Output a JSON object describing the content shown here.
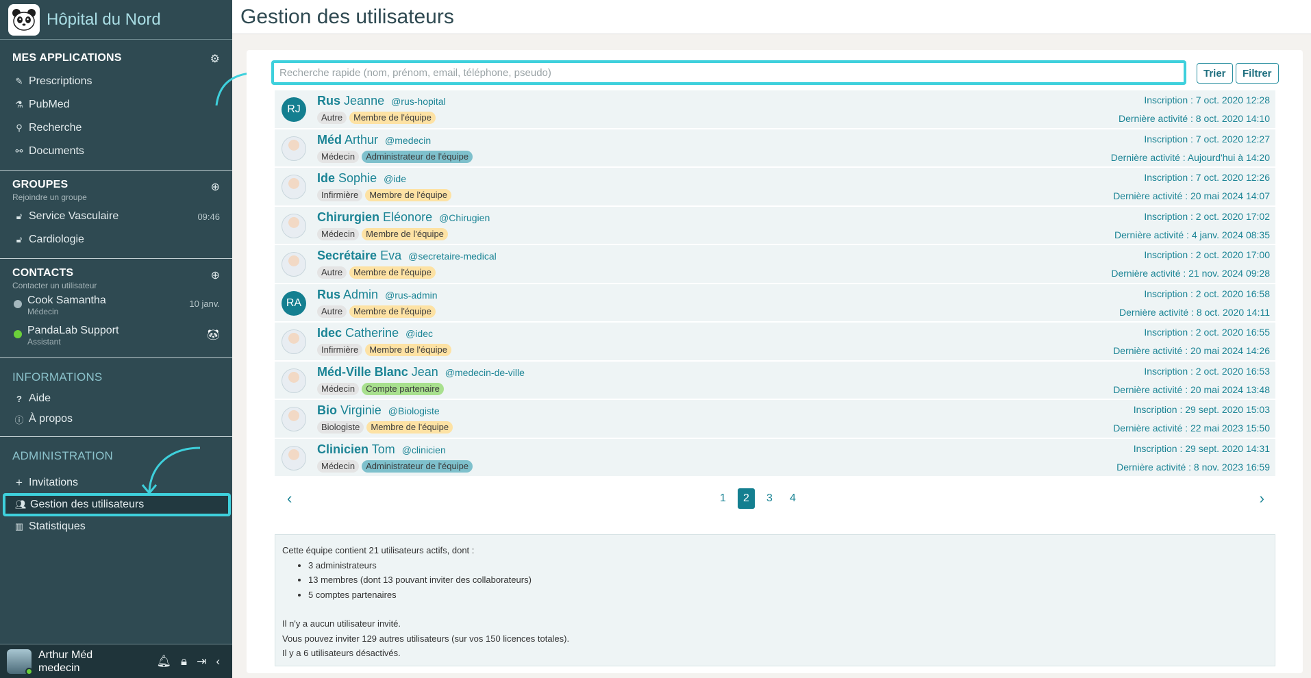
{
  "sidebar": {
    "brand": "Hôpital du Nord",
    "apps": {
      "title": "MES APPLICATIONS",
      "items": [
        {
          "label": "Prescriptions",
          "icon": "prescription-icon"
        },
        {
          "label": "PubMed",
          "icon": "pubmed-icon"
        },
        {
          "label": "Recherche",
          "icon": "search-icon"
        },
        {
          "label": "Documents",
          "icon": "paperclip-icon"
        }
      ]
    },
    "groups": {
      "title": "GROUPES",
      "subtitle": "Rejoindre un groupe",
      "items": [
        {
          "label": "Service Vasculaire",
          "meta": "09:46"
        },
        {
          "label": "Cardiologie",
          "meta": ""
        }
      ]
    },
    "contacts": {
      "title": "CONTACTS",
      "subtitle": "Contacter un utilisateur",
      "items": [
        {
          "name": "Cook Samantha",
          "role": "Médecin",
          "meta": "10 janv."
        },
        {
          "name": "PandaLab Support",
          "role": "Assistant",
          "meta": ""
        }
      ]
    },
    "informations": {
      "title": "INFORMATIONS",
      "items": [
        {
          "label": "Aide"
        },
        {
          "label": "À propos"
        }
      ]
    },
    "administration": {
      "title": "ADMINISTRATION",
      "items": [
        {
          "label": "Invitations"
        },
        {
          "label": "Gestion des utilisateurs"
        },
        {
          "label": "Statistiques"
        }
      ]
    },
    "user": {
      "first": "Arthur Méd",
      "second": "medecin"
    }
  },
  "header": {
    "title": "Gestion des utilisateurs"
  },
  "search": {
    "placeholder": "Recherche rapide (nom, prénom, email, téléphone, pseudo)"
  },
  "buttons": {
    "sort": "Trier",
    "filter": "Filtrer"
  },
  "users": [
    {
      "last": "Rus",
      "first": "Jeanne",
      "handle": "@rus-hopital",
      "role": "Autre",
      "tag": "Membre de l'équipe",
      "tag_type": "membre",
      "initials": "RJ",
      "ins": "Inscription : 7 oct. 2020 12:28",
      "act": "Dernière activité : 8 oct. 2020 14:10"
    },
    {
      "last": "Méd",
      "first": "Arthur",
      "handle": "@medecin",
      "role": "Médecin",
      "tag": "Administrateur de l'équipe",
      "tag_type": "admin",
      "initials": "",
      "ins": "Inscription : 7 oct. 2020 12:27",
      "act": "Dernière activité : Aujourd'hui à 14:20"
    },
    {
      "last": "Ide",
      "first": "Sophie",
      "handle": "@ide",
      "role": "Infirmière",
      "tag": "Membre de l'équipe",
      "tag_type": "membre",
      "initials": "",
      "ins": "Inscription : 7 oct. 2020 12:26",
      "act": "Dernière activité : 20 mai 2024 14:07"
    },
    {
      "last": "Chirurgien",
      "first": "Eléonore",
      "handle": "@Chirugien",
      "role": "Médecin",
      "tag": "Membre de l'équipe",
      "tag_type": "membre",
      "initials": "",
      "ins": "Inscription : 2 oct. 2020 17:02",
      "act": "Dernière activité : 4 janv. 2024 08:35"
    },
    {
      "last": "Secrétaire",
      "first": "Eva",
      "handle": "@secretaire-medical",
      "role": "Autre",
      "tag": "Membre de l'équipe",
      "tag_type": "membre",
      "initials": "",
      "ins": "Inscription : 2 oct. 2020 17:00",
      "act": "Dernière activité : 21 nov. 2024 09:28"
    },
    {
      "last": "Rus",
      "first": "Admin",
      "handle": "@rus-admin",
      "role": "Autre",
      "tag": "Membre de l'équipe",
      "tag_type": "membre",
      "initials": "RA",
      "ins": "Inscription : 2 oct. 2020 16:58",
      "act": "Dernière activité : 8 oct. 2020 14:11"
    },
    {
      "last": "Idec",
      "first": "Catherine",
      "handle": "@idec",
      "role": "Infirmière",
      "tag": "Membre de l'équipe",
      "tag_type": "membre",
      "initials": "",
      "ins": "Inscription : 2 oct. 2020 16:55",
      "act": "Dernière activité : 20 mai 2024 14:26"
    },
    {
      "last": "Méd-Ville Blanc",
      "first": "Jean",
      "handle": "@medecin-de-ville",
      "role": "Médecin",
      "tag": "Compte partenaire",
      "tag_type": "part",
      "initials": "",
      "ins": "Inscription : 2 oct. 2020 16:53",
      "act": "Dernière activité : 20 mai 2024 13:48"
    },
    {
      "last": "Bio",
      "first": "Virginie",
      "handle": "@Biologiste",
      "role": "Biologiste",
      "tag": "Membre de l'équipe",
      "tag_type": "membre",
      "initials": "",
      "ins": "Inscription : 29 sept. 2020 15:03",
      "act": "Dernière activité : 22 mai 2023 15:50"
    },
    {
      "last": "Clinicien",
      "first": "Tom",
      "handle": "@clinicien",
      "role": "Médecin",
      "tag": "Administrateur de l'équipe",
      "tag_type": "admin",
      "initials": "",
      "ins": "Inscription : 29 sept. 2020 14:31",
      "act": "Dernière activité : 8 nov. 2023 16:59"
    }
  ],
  "pagination": {
    "pages": [
      "1",
      "2",
      "3",
      "4"
    ],
    "current": "2",
    "prev": "‹",
    "next": "›"
  },
  "summary": {
    "intro": "Cette équipe contient 21 utilisateurs actifs, dont :",
    "bullets": [
      "3 administrateurs",
      "13 membres (dont 13 pouvant inviter des collaborateurs)",
      "5 comptes partenaires"
    ],
    "line1": "Il n'y a aucun utilisateur invité.",
    "line2": "Vous pouvez inviter 129 autres utilisateurs (sur vos 150 licences totales).",
    "line3": "Il y a 6 utilisateurs désactivés."
  },
  "colors": {
    "sidebar": "#2f4a52",
    "accent": "#1b8495",
    "highlight": "#3ed0dc"
  }
}
